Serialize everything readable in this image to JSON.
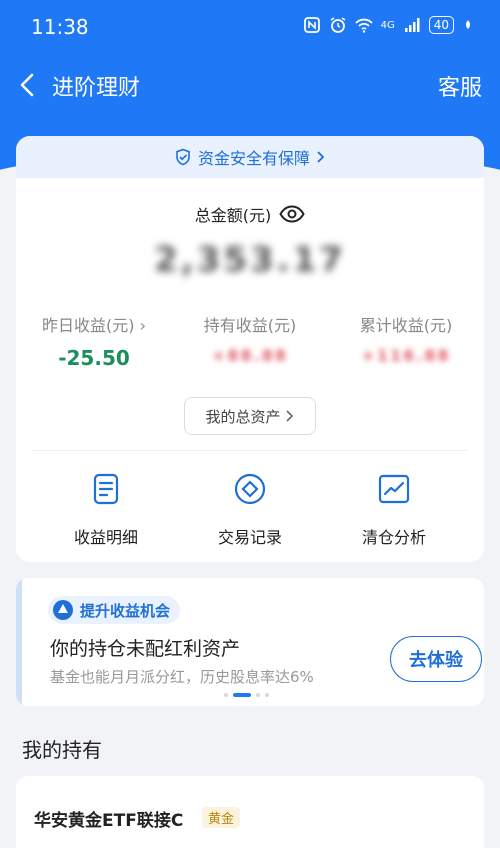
{
  "status_bar": {
    "time": "11:38",
    "network": "4G",
    "battery": "40"
  },
  "nav": {
    "title": "进阶理财",
    "service": "客服"
  },
  "summary": {
    "security_text": "资金安全有保障",
    "total_label": "总金额(元)",
    "total_value": "2,353.17",
    "yesterday_label": "昨日收益(元)",
    "yesterday_value": "-25.50",
    "holding_label": "持有收益(元)",
    "holding_value": "+88.88",
    "cumulative_label": "累计收益(元)",
    "cumulative_value": "+116.88",
    "assets_button": "我的总资产"
  },
  "actions": [
    {
      "label": "收益明细",
      "icon": "document-icon"
    },
    {
      "label": "交易记录",
      "icon": "diamond-circle-icon"
    },
    {
      "label": "清仓分析",
      "icon": "chart-icon"
    }
  ],
  "promo": {
    "tag": "提升收益机会",
    "title": "你的持仓未配红利资产",
    "subtitle": "基金也能月月派分红，历史股息率达6%",
    "button": "去体验"
  },
  "holdings": {
    "section_title": "我的持有",
    "items": [
      {
        "name": "华安黄金ETF联接C",
        "tag": "黄金"
      }
    ]
  },
  "colors": {
    "brand": "#1f78f5",
    "gain_down": "#1b8f5a",
    "tag_gold": "#b8860b"
  }
}
